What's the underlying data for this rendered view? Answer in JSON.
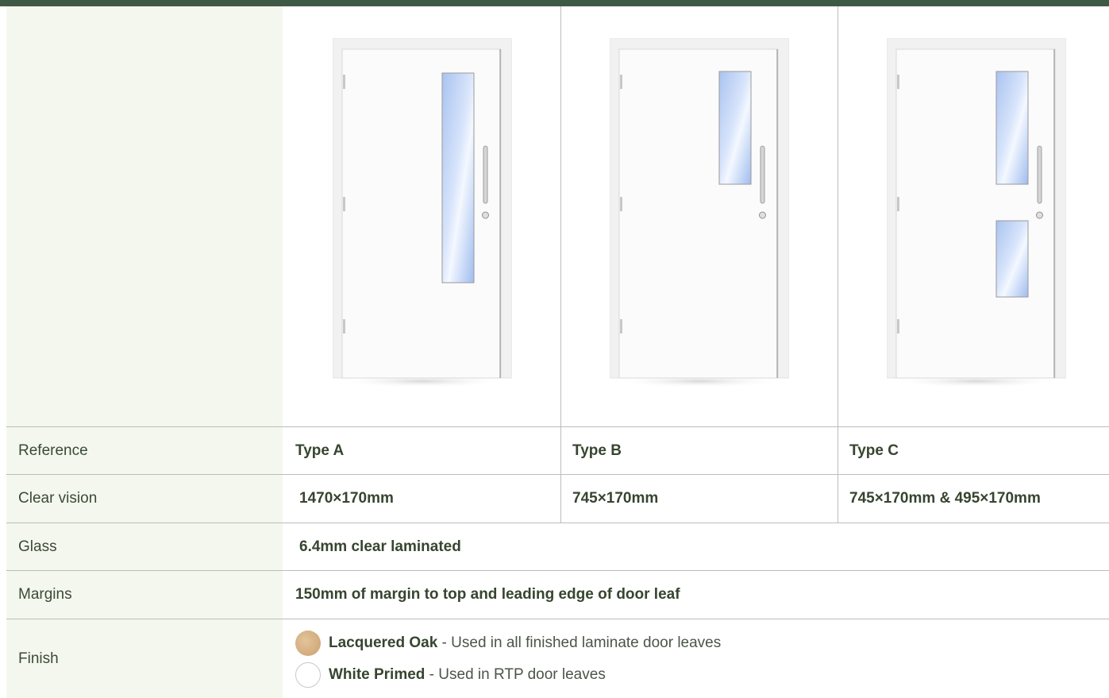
{
  "rows": {
    "reference": {
      "label": "Reference",
      "values": [
        "Type A",
        "Type B",
        "Type C"
      ]
    },
    "clear_vision": {
      "label": "Clear vision",
      "values": [
        "1470×170mm",
        "745×170mm",
        "745×170mm & 495×170mm"
      ]
    },
    "glass": {
      "label": "Glass",
      "value": "6.4mm clear laminated"
    },
    "margins": {
      "label": "Margins",
      "value": "150mm of margin to top and leading edge of door leaf"
    },
    "finish": {
      "label": "Finish",
      "items": [
        {
          "name": "Lacquered Oak",
          "desc": " - Used in all finished laminate door leaves",
          "swatch": "oak"
        },
        {
          "name": "White Primed",
          "desc": " - Used in RTP door leaves",
          "swatch": "white"
        }
      ]
    }
  },
  "colors": {
    "topbar": "#3f5a44",
    "label_bg": "#f4f7ee",
    "text": "#36452f",
    "glass": "#b9cff5"
  }
}
